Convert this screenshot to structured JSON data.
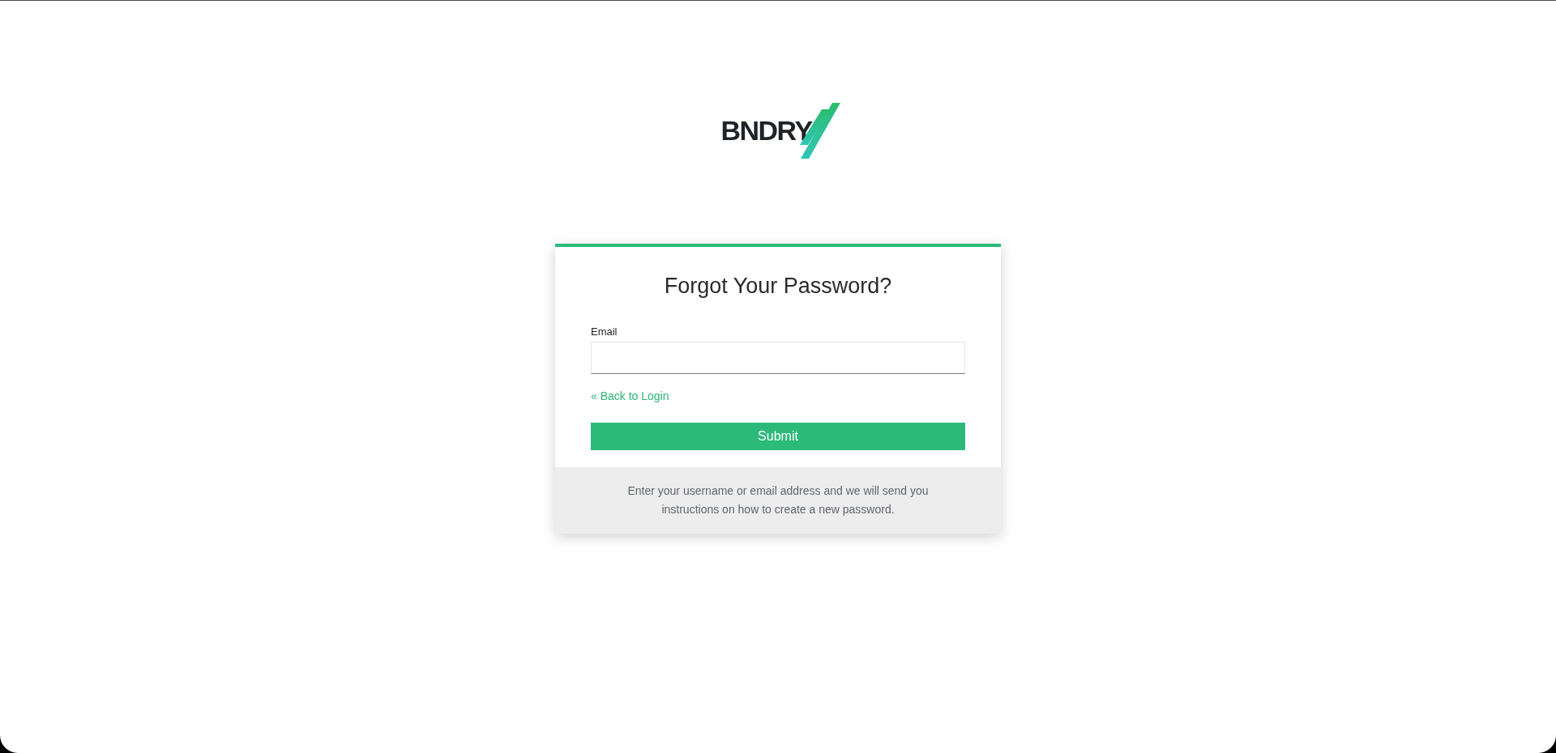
{
  "logo": {
    "wordmark": "BNDRY"
  },
  "card": {
    "title": "Forgot Your Password?",
    "email_field": {
      "label": "Email"
    },
    "back_link": "« Back to Login",
    "submit_button": "Submit",
    "footer_text": "Enter your username or email address and we will send you instructions on how to create a new password."
  }
}
